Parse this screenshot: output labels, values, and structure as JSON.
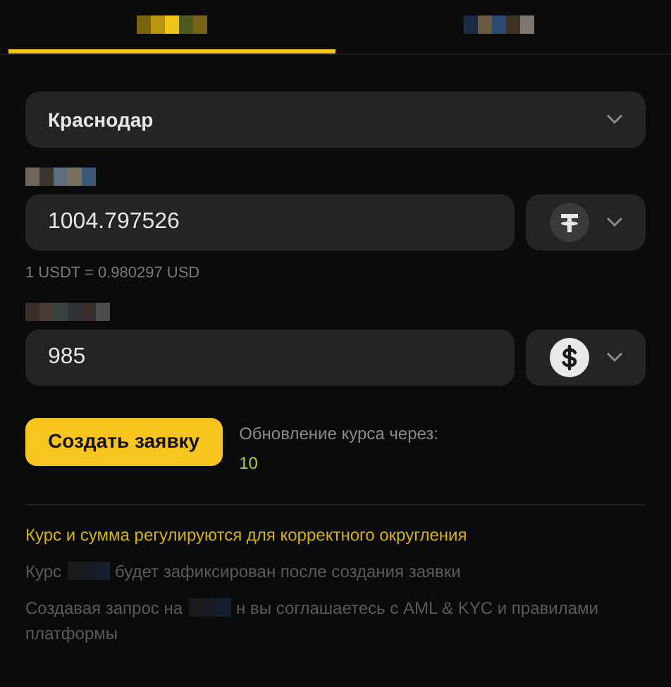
{
  "tabs": [
    {
      "selected": true
    },
    {
      "selected": false
    }
  ],
  "city_select": {
    "value": "Краснодар"
  },
  "give": {
    "value": "1004.797526",
    "currency_icon": {
      "kind": "tether"
    }
  },
  "rate": "1 USDT = 0.980297 USD",
  "receive": {
    "value": "985",
    "currency_icon": {
      "kind": "dollar"
    }
  },
  "create_button": "Создать заявку",
  "refresh": {
    "label": "Обновление курса через:",
    "countdown": "10"
  },
  "notes": [
    {
      "kind": "warning",
      "segments": [
        {
          "kind": "text",
          "text": "Курс и сумма регулируются для корректного округления"
        }
      ]
    },
    {
      "kind": "info",
      "segments": [
        {
          "kind": "text",
          "text": "Курс"
        },
        {
          "kind": "redacted"
        },
        {
          "kind": "text",
          "text": "будет зафиксирован после создания заявки"
        }
      ]
    },
    {
      "kind": "info",
      "segments": [
        {
          "kind": "text",
          "text": "Создавая запрос на"
        },
        {
          "kind": "redacted"
        },
        {
          "kind": "text",
          "text": "н вы соглашаетесь с AML & KYC и правилами"
        },
        {
          "kind": "text",
          "text": "платформы"
        }
      ]
    }
  ]
}
